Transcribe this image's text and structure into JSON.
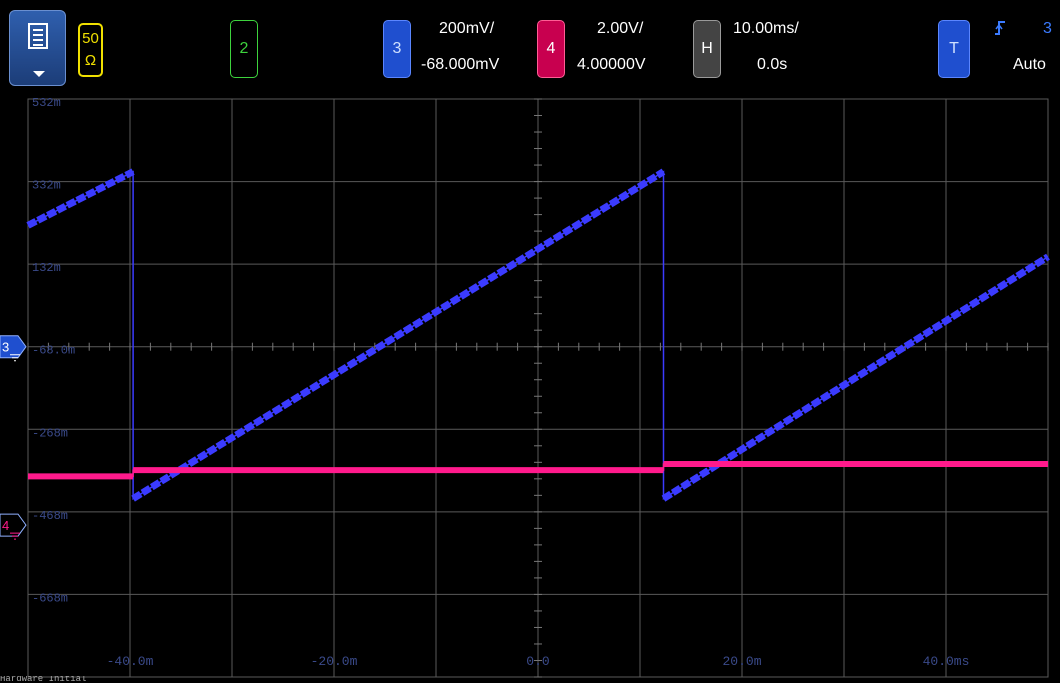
{
  "toolbar": {
    "input_impedance": {
      "value": "50",
      "unit": "Ω"
    },
    "channel2": {
      "label": "2",
      "color": "#3dd33d"
    },
    "channel3": {
      "label": "3",
      "scale": "200mV/",
      "offset": "-68.000mV",
      "color": "#3b3bff"
    },
    "channel4": {
      "label": "4",
      "scale": "2.00V/",
      "offset": "4.00000V",
      "color": "#ff1a8c"
    },
    "horizontal": {
      "label": "H",
      "scale": "10.00ms/",
      "delay": "0.0s"
    },
    "trigger": {
      "label": "T",
      "source": "3",
      "mode": "Auto",
      "icon": "rising-edge-icon"
    }
  },
  "screen": {
    "y_labels": [
      "532m",
      "332m",
      "132m",
      "-68.0m",
      "-268m",
      "-468m",
      "-668m"
    ],
    "x_labels": [
      "-40.0m",
      "-20.0m",
      "0.0",
      "20.0m",
      "40.0ms"
    ],
    "markers": {
      "ch3": "3",
      "ch4": "4"
    },
    "grid_color": "#5a5a5a",
    "label_color": "#3a4a8a"
  },
  "chart_data": {
    "type": "line",
    "xlabel": "",
    "ylabel": "",
    "xlim": [
      -50,
      50
    ],
    "ylim": [
      -868,
      532
    ],
    "series": [
      {
        "name": "3",
        "color": "#3b3bff",
        "x": [
          -50,
          -39.7,
          -39.7,
          12.3,
          12.3,
          50
        ],
        "y": [
          226,
          356,
          -436,
          356,
          -436,
          150
        ]
      },
      {
        "name": "4",
        "color": "#ff1a8c",
        "x": [
          -50,
          -39.7,
          -39.7,
          12.3,
          12.3,
          50
        ],
        "y": [
          -382,
          -382,
          -367,
          -367,
          -352,
          -352
        ]
      }
    ]
  },
  "footer": {
    "text": "Hardware Initial"
  }
}
